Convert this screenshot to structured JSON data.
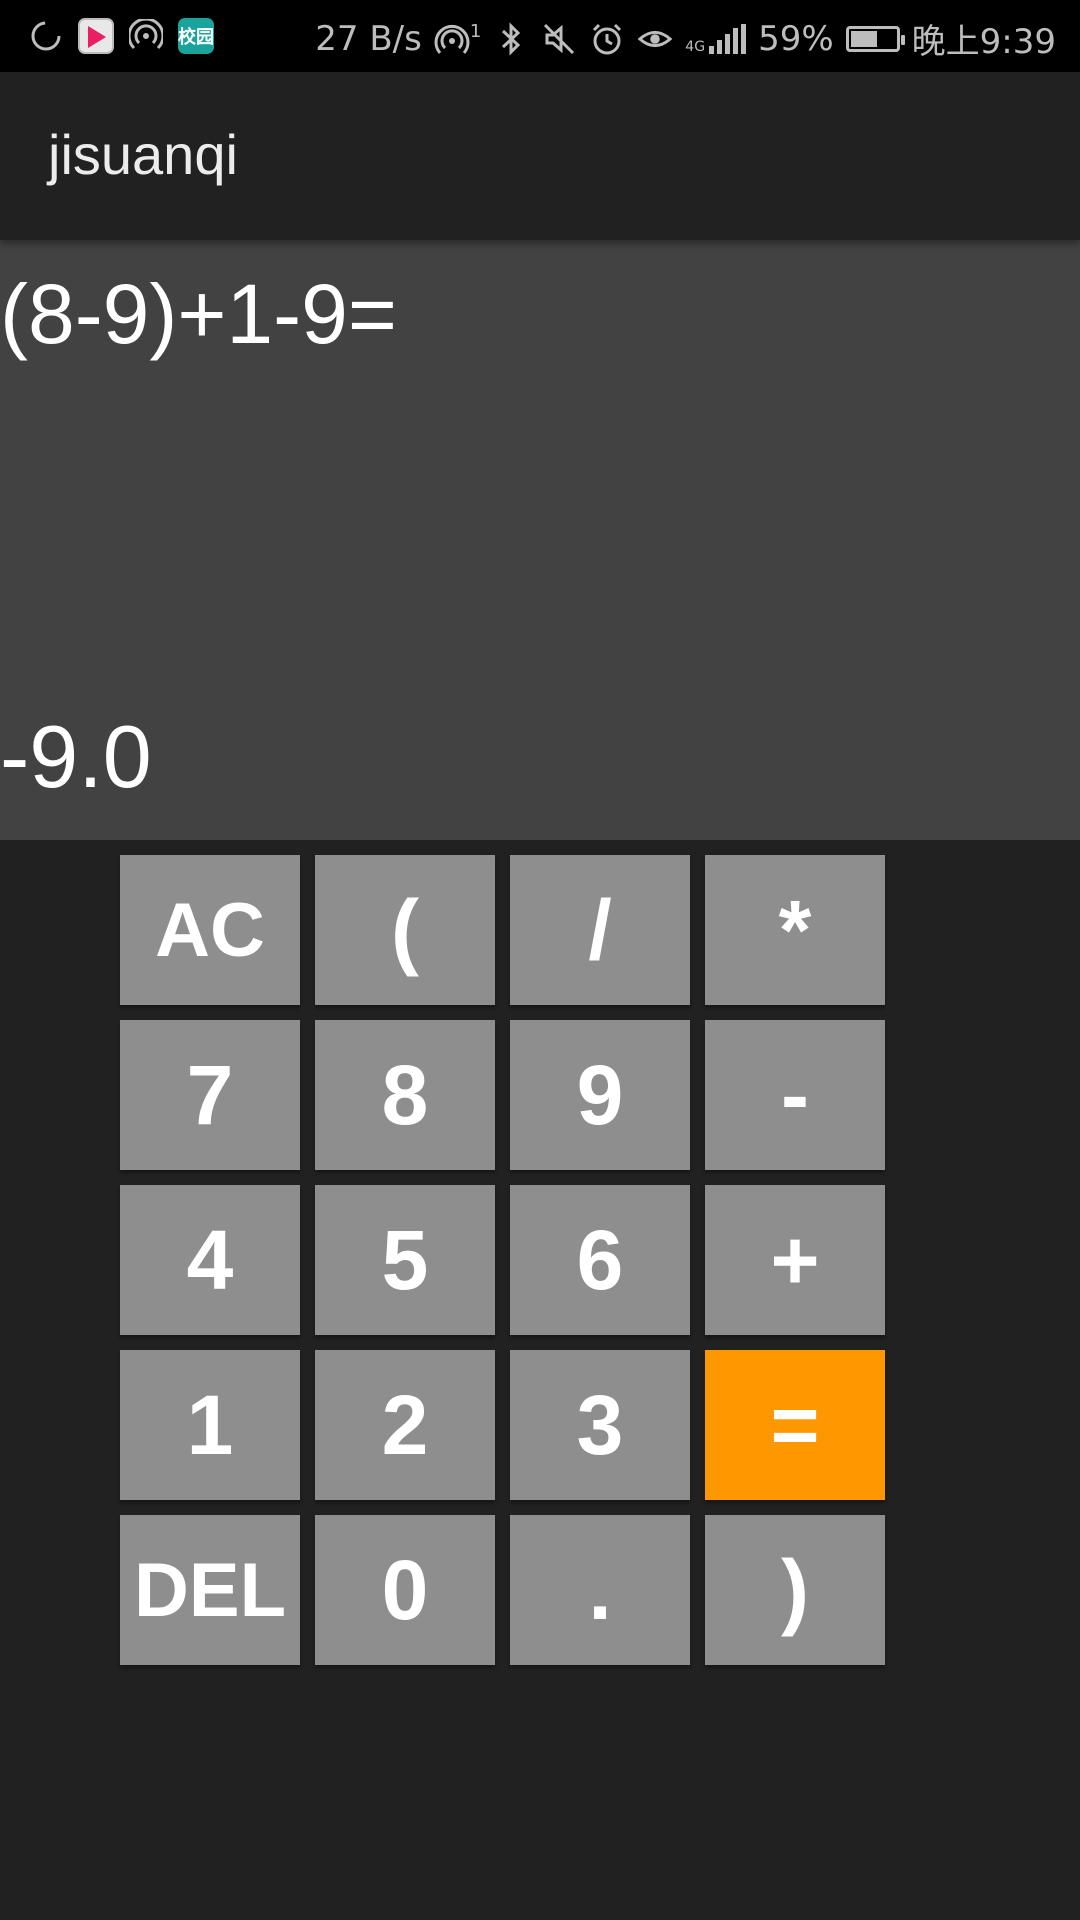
{
  "status_bar": {
    "network_speed": "27 B/s",
    "hotspot_count": "1",
    "network_type": "4G",
    "battery_percent": "59%",
    "battery_level": 0.59,
    "time": "晚上9:39",
    "app_icons": [
      "loading-icon",
      "youku-app-icon",
      "hotspot-icon",
      "campus-app-icon"
    ],
    "campus_app_label": "校园"
  },
  "app_bar": {
    "title": "jisuanqi"
  },
  "display": {
    "expression": "(8-9)+1-9=",
    "result": "-9.0"
  },
  "keypad": {
    "keys": [
      {
        "label": "AC",
        "name": "ac-button"
      },
      {
        "label": "(",
        "name": "open-paren-button"
      },
      {
        "label": "/",
        "name": "divide-button"
      },
      {
        "label": "*",
        "name": "multiply-button"
      },
      {
        "label": "7",
        "name": "seven-button"
      },
      {
        "label": "8",
        "name": "eight-button"
      },
      {
        "label": "9",
        "name": "nine-button"
      },
      {
        "label": "-",
        "name": "minus-button"
      },
      {
        "label": "4",
        "name": "four-button"
      },
      {
        "label": "5",
        "name": "five-button"
      },
      {
        "label": "6",
        "name": "six-button"
      },
      {
        "label": "+",
        "name": "plus-button"
      },
      {
        "label": "1",
        "name": "one-button"
      },
      {
        "label": "2",
        "name": "two-button"
      },
      {
        "label": "3",
        "name": "three-button"
      },
      {
        "label": "=",
        "name": "equals-button"
      },
      {
        "label": "DEL",
        "name": "delete-button"
      },
      {
        "label": "0",
        "name": "zero-button"
      },
      {
        "label": ".",
        "name": "decimal-button"
      },
      {
        "label": ")",
        "name": "close-paren-button"
      }
    ]
  },
  "colors": {
    "background": "#212121",
    "display_background": "#424242",
    "key_background": "#8e8e8e",
    "accent": "#ff9800",
    "text": "#ffffff"
  }
}
